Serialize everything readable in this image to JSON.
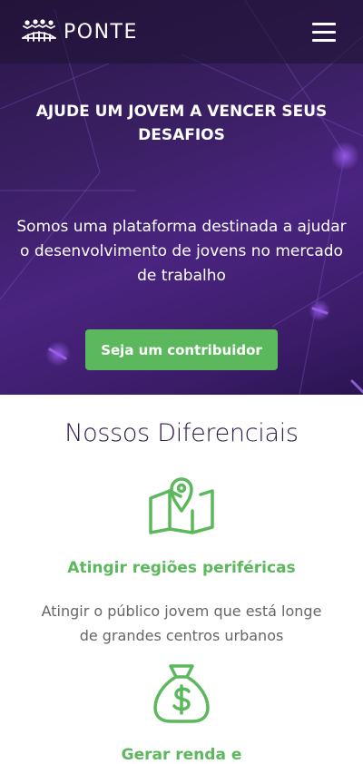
{
  "brand": {
    "name": "PONTE",
    "logo_icon": "people-bridge-logo"
  },
  "nav": {
    "menu_icon": "hamburger-menu-icon"
  },
  "hero": {
    "title": "AJUDE UM JOVEM A VENCER SEUS DESAFIOS",
    "subtitle": "Somos uma plataforma destinada a ajudar o desenvolvimento de jovens no mercado de trabalho",
    "cta_label": "Seja um contribuidor"
  },
  "differentials": {
    "title": "Nossos Diferenciais",
    "items": [
      {
        "icon": "map-pin-icon",
        "title": "Atingir regiões periféricas",
        "description": "Atingir o público jovem que está longe de grandes centros urbanos"
      },
      {
        "icon": "money-bag-icon",
        "title": "Gerar renda e"
      }
    ]
  },
  "colors": {
    "accent": "#5cb85c",
    "hero_bg": "#3a1f62",
    "heading": "#2c1a4a"
  }
}
